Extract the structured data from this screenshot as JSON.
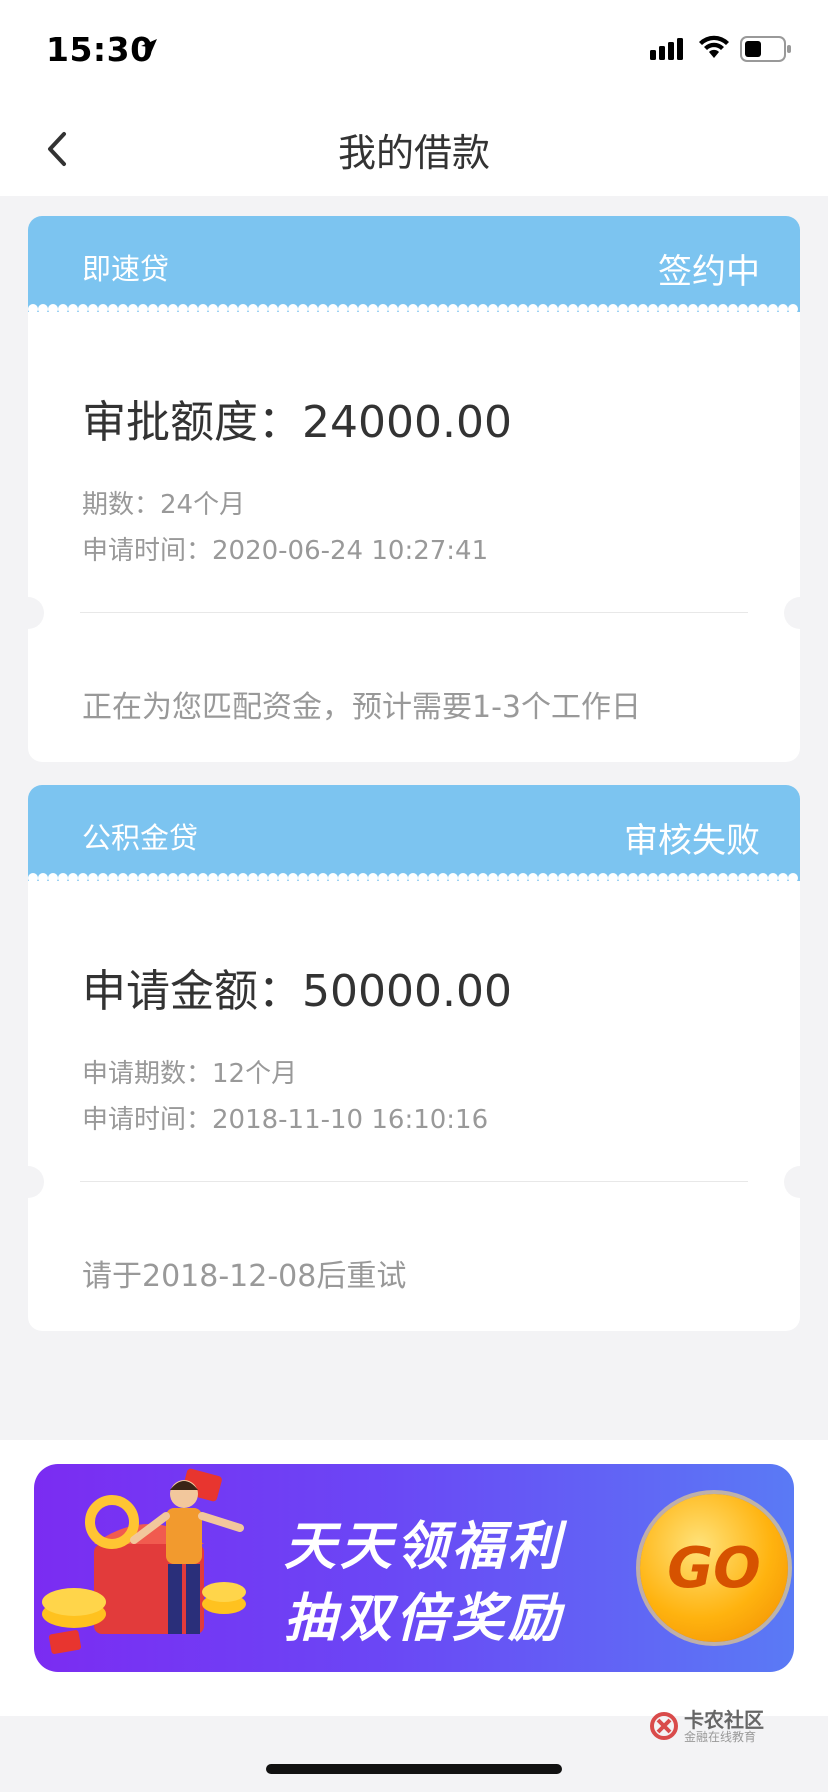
{
  "status_bar": {
    "time": "15:30"
  },
  "header": {
    "title": "我的借款"
  },
  "loans": [
    {
      "product": "即速贷",
      "status": "签约中",
      "amount_line": "审批额度：24000.00",
      "meta1": "期数：24个月",
      "meta2": "申请时间：2020-06-24 10:27:41",
      "note": "正在为您匹配资金，预计需要1-3个工作日"
    },
    {
      "product": "公积金贷",
      "status": "审核失败",
      "amount_line": "申请金额：50000.00",
      "meta1": "申请期数：12个月",
      "meta2": "申请时间：2018-11-10 16:10:16",
      "note": "请于2018-12-08后重试"
    }
  ],
  "banner": {
    "line1": "天天领福利",
    "line2": "抽双倍奖励",
    "button": "GO"
  },
  "watermark": {
    "name": "卡农社区",
    "tagline": "金融在线教育"
  },
  "colors": {
    "card_header": "#7cc4f0",
    "background": "#f3f3f5",
    "banner_start": "#7b2cf2",
    "banner_end": "#5a7af5"
  }
}
